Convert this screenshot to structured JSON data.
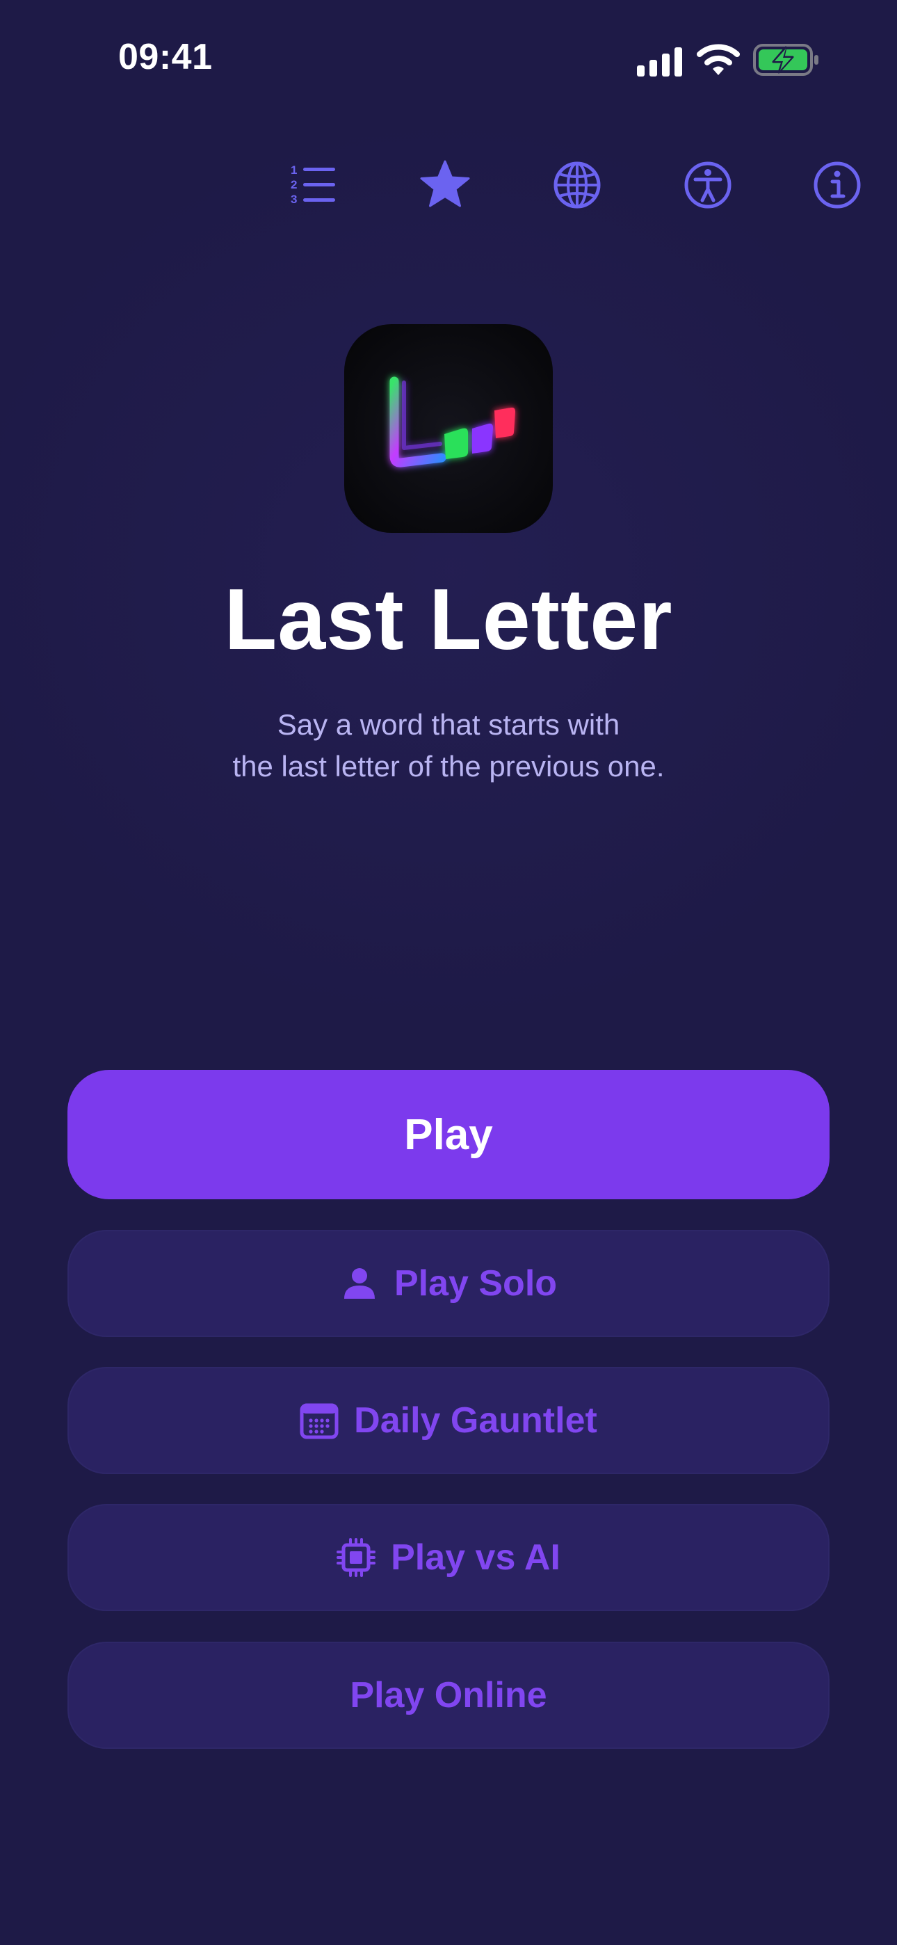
{
  "status_bar": {
    "time": "09:41"
  },
  "toolbar": {
    "icons": [
      "numbered-list-icon",
      "star-icon",
      "globe-icon",
      "accessibility-icon",
      "info-icon"
    ],
    "accent_color": "#6b63f0"
  },
  "app": {
    "title": "Last Letter",
    "subtitle_line1": "Say a word that starts with",
    "subtitle_line2": "the last letter of the previous one."
  },
  "buttons": {
    "play": "Play",
    "play_solo": "Play Solo",
    "daily_gauntlet": "Daily Gauntlet",
    "play_vs_ai": "Play vs AI",
    "play_online": "Play Online"
  },
  "colors": {
    "background": "#1e1a47",
    "primary": "#7c3aed",
    "secondary_button": "#2a2262",
    "battery": "#34c759"
  }
}
